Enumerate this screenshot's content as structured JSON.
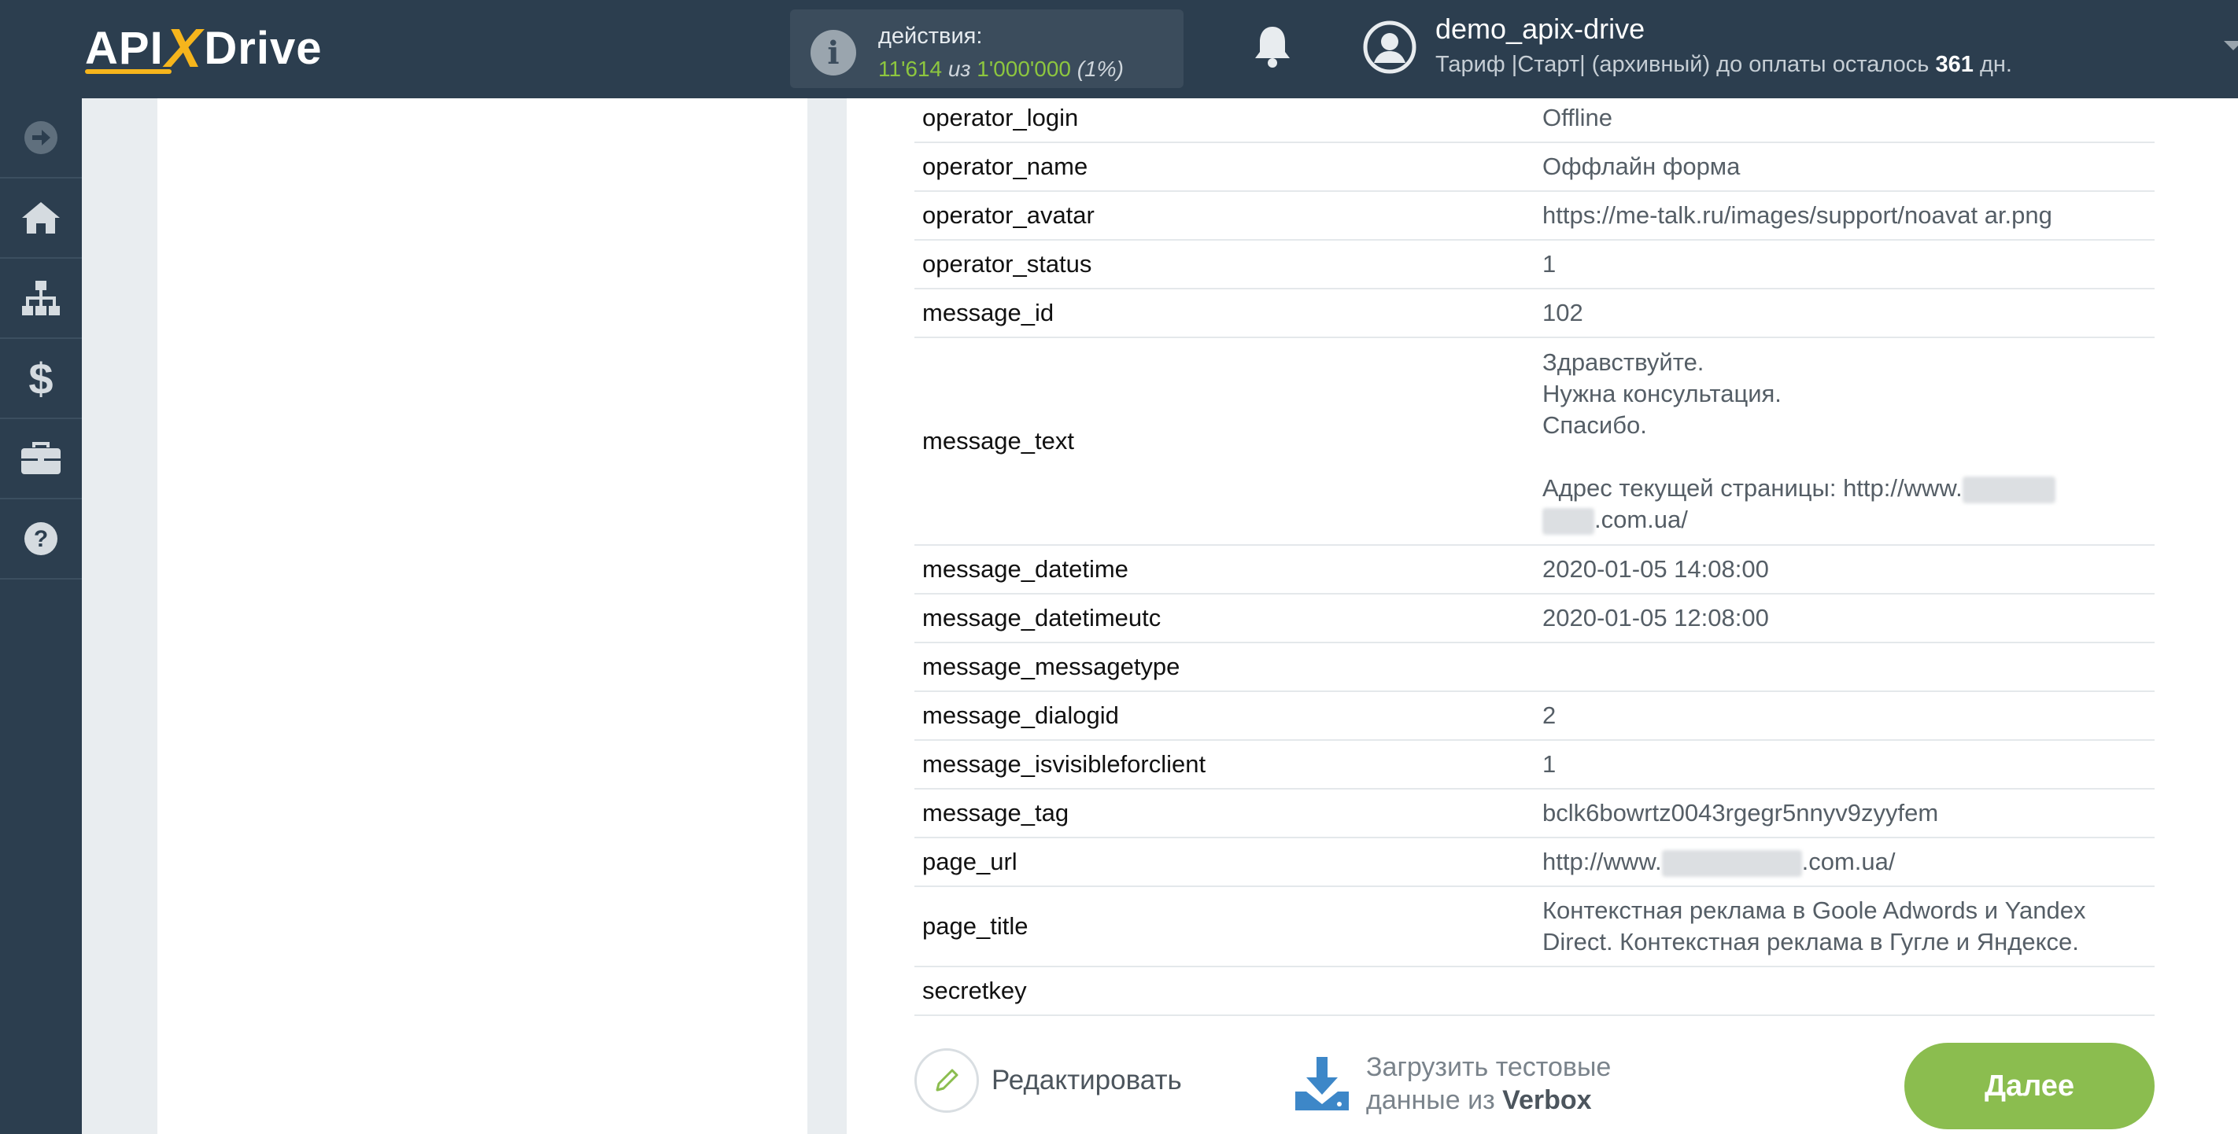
{
  "header": {
    "logo_api": "API",
    "logo_x": "X",
    "logo_drive": "Drive",
    "actions_label": "действия:",
    "actions_used": "11'614",
    "actions_of": "из",
    "actions_total": "1'000'000",
    "actions_percent": "(1%)",
    "username": "demo_apix-drive",
    "tariff_text": "Тариф |Старт| (архивный) до оплаты осталось",
    "tariff_days": "361",
    "tariff_suffix": "дн."
  },
  "sidebar": {
    "items": [
      {
        "icon": "arrow-right-circle-icon"
      },
      {
        "icon": "home-icon"
      },
      {
        "icon": "sitemap-icon"
      },
      {
        "icon": "dollar-icon"
      },
      {
        "icon": "briefcase-icon"
      },
      {
        "icon": "help-icon"
      }
    ]
  },
  "fields": [
    {
      "key": "operator_login",
      "value": "Offline"
    },
    {
      "key": "operator_name",
      "value": "Оффлайн форма"
    },
    {
      "key": "operator_avatar",
      "value": "https://me-talk.ru/images/support/noavat ar.png"
    },
    {
      "key": "operator_status",
      "value": "1"
    },
    {
      "key": "message_id",
      "value": "102"
    },
    {
      "key": "message_text",
      "value_lines": [
        "Здравствуйте.",
        "Нужна консультация.",
        "Спасибо.",
        "",
        "Адрес текущей страницы: http://www.",
        ".com.ua/"
      ]
    },
    {
      "key": "message_datetime",
      "value": "2020-01-05 14:08:00"
    },
    {
      "key": "message_datetimeutc",
      "value": "2020-01-05 12:08:00"
    },
    {
      "key": "message_messagetype",
      "value": ""
    },
    {
      "key": "message_dialogid",
      "value": "2"
    },
    {
      "key": "message_isvisibleforclient",
      "value": "1"
    },
    {
      "key": "message_tag",
      "value": "bclk6bowrtz0043rgegr5nnyv9zyyfem"
    },
    {
      "key": "page_url",
      "value_prefix": "http://www.",
      "value_suffix": ".com.ua/"
    },
    {
      "key": "page_title",
      "value_lines": [
        "Контекстная реклама в Goole Adwords и Yandex",
        "Direct. Контекстная реклама в Гугле и Яндексе."
      ]
    },
    {
      "key": "secretkey",
      "value": ""
    }
  ],
  "actions": {
    "edit_label": "Редактировать",
    "load_label_line1": "Загрузить тестовые",
    "load_label_line2": "данные из",
    "load_label_source": "Verbox",
    "next_label": "Далее"
  },
  "colors": {
    "header_bg": "#2c3e4f",
    "accent_yellow": "#f6b51c",
    "accent_green": "#8dc63f",
    "button_green": "#8bbd4f",
    "download_blue": "#3d87c8"
  }
}
